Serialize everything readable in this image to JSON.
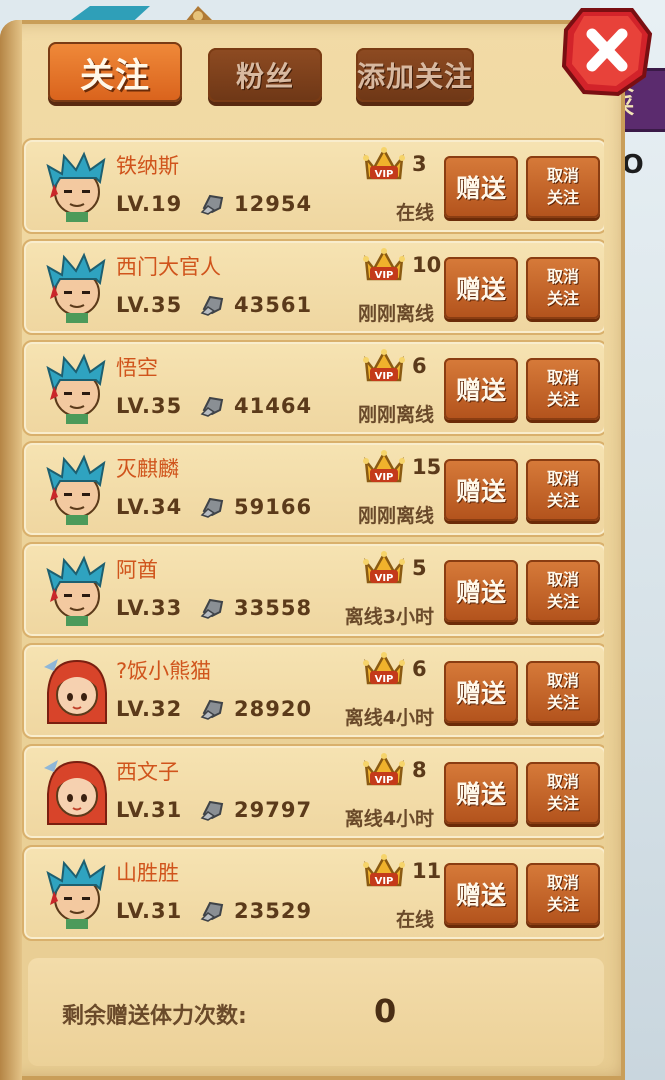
{
  "tabs": {
    "follow": "关注",
    "fans": "粉丝",
    "add_follow": "添加关注"
  },
  "background": {
    "strip_text": "天\n采",
    "side_text": "IO"
  },
  "friends": [
    {
      "name": "铁纳斯",
      "level": "LV.19",
      "power": "12954",
      "vip": "3",
      "status": "在线",
      "avatar": "male-hero-avatar"
    },
    {
      "name": "西门大官人",
      "level": "LV.35",
      "power": "43561",
      "vip": "10",
      "status": "刚刚离线",
      "avatar": "male-hero-avatar"
    },
    {
      "name": "悟空",
      "level": "LV.35",
      "power": "41464",
      "vip": "6",
      "status": "刚刚离线",
      "avatar": "male-hero-avatar"
    },
    {
      "name": "灭麒麟",
      "level": "LV.34",
      "power": "59166",
      "vip": "15",
      "status": "刚刚离线",
      "avatar": "male-hero-avatar"
    },
    {
      "name": "阿酋",
      "level": "LV.33",
      "power": "33558",
      "vip": "5",
      "status": "离线3小时",
      "avatar": "male-hero-avatar"
    },
    {
      "name": "?饭小熊猫",
      "level": "LV.32",
      "power": "28920",
      "vip": "6",
      "status": "离线4小时",
      "avatar": "female-hero-avatar"
    },
    {
      "name": "西文子",
      "level": "LV.31",
      "power": "29797",
      "vip": "8",
      "status": "离线4小时",
      "avatar": "female-hero-avatar"
    },
    {
      "name": "山胜胜",
      "level": "LV.31",
      "power": "23529",
      "vip": "11",
      "status": "在线",
      "avatar": "male-hero-avatar"
    }
  ],
  "buttons": {
    "gift": "赠送",
    "unfollow_line1": "取消",
    "unfollow_line2": "关注"
  },
  "footer": {
    "label": "剩余赠送体力次数:",
    "value": "0"
  },
  "colors": {
    "parchment": "#efd6a0",
    "accent_orange": "#d9621c",
    "name_text": "#d0541c",
    "close_red": "#d2232a"
  }
}
